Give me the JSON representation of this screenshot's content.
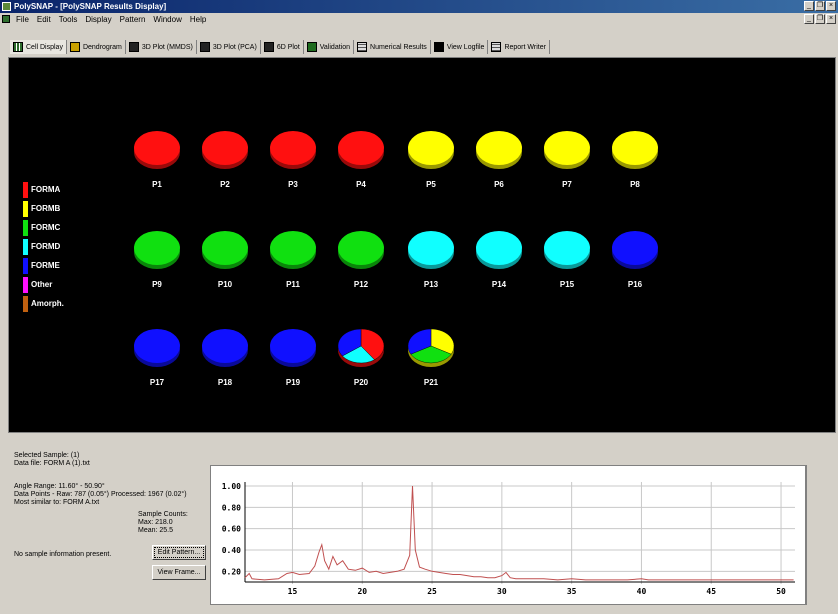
{
  "window": {
    "title": "PolySNAP - [PolySNAP Results Display]"
  },
  "menu": [
    "File",
    "Edit",
    "Tools",
    "Display",
    "Pattern",
    "Window",
    "Help"
  ],
  "tabs": [
    {
      "label": "Cell Display",
      "icon": "grid-icon"
    },
    {
      "label": "Dendrogram",
      "icon": "dendrogram-icon"
    },
    {
      "label": "3D Plot (MMDS)",
      "icon": "plot3d-icon"
    },
    {
      "label": "3D Plot (PCA)",
      "icon": "plot3d-icon"
    },
    {
      "label": "6D Plot",
      "icon": "plot6d-icon"
    },
    {
      "label": "Validation",
      "icon": "validation-icon"
    },
    {
      "label": "Numerical Results",
      "icon": "table-icon"
    },
    {
      "label": "View Logfile",
      "icon": "logfile-icon"
    },
    {
      "label": "Report Writer",
      "icon": "report-icon"
    }
  ],
  "legend": [
    {
      "label": "FORMA",
      "color": "#ff1010"
    },
    {
      "label": "FORMB",
      "color": "#ffff00"
    },
    {
      "label": "FORMC",
      "color": "#10e010"
    },
    {
      "label": "FORMD",
      "color": "#10ffff"
    },
    {
      "label": "FORME",
      "color": "#1010ff"
    },
    {
      "label": "Other",
      "color": "#ff10ff"
    },
    {
      "label": "Amorph.",
      "color": "#c06010"
    }
  ],
  "cells": [
    {
      "label": "P1",
      "color": "#ff1010"
    },
    {
      "label": "P2",
      "color": "#ff1010"
    },
    {
      "label": "P3",
      "color": "#ff1010"
    },
    {
      "label": "P4",
      "color": "#ff1010"
    },
    {
      "label": "P5",
      "color": "#ffff00"
    },
    {
      "label": "P6",
      "color": "#ffff00"
    },
    {
      "label": "P7",
      "color": "#ffff00"
    },
    {
      "label": "P8",
      "color": "#ffff00"
    },
    {
      "label": "P9",
      "color": "#10e010"
    },
    {
      "label": "P10",
      "color": "#10e010"
    },
    {
      "label": "P11",
      "color": "#10e010"
    },
    {
      "label": "P12",
      "color": "#10e010"
    },
    {
      "label": "P13",
      "color": "#10ffff"
    },
    {
      "label": "P14",
      "color": "#10ffff"
    },
    {
      "label": "P15",
      "color": "#10ffff"
    },
    {
      "label": "P16",
      "color": "#1010ff"
    },
    {
      "label": "P17",
      "color": "#1010ff"
    },
    {
      "label": "P18",
      "color": "#1010ff"
    },
    {
      "label": "P19",
      "color": "#1010ff"
    },
    {
      "label": "P20",
      "pie": [
        {
          "color": "#ff1010",
          "frac": 0.4
        },
        {
          "color": "#10ffff",
          "frac": 0.25
        },
        {
          "color": "#1010ff",
          "frac": 0.35
        }
      ]
    },
    {
      "label": "P21",
      "pie": [
        {
          "color": "#ffff00",
          "frac": 0.33
        },
        {
          "color": "#10e010",
          "frac": 0.34
        },
        {
          "color": "#1010ff",
          "frac": 0.33
        }
      ]
    }
  ],
  "info": {
    "selected": "Selected Sample: (1)",
    "datafile": "Data file: FORM A (1).txt",
    "angle_range": "Angle Range:          11.60° - 50.90°",
    "data_points": "Data Points - Raw: 787 (0.05°)   Processed: 1967 (0.02°)",
    "most_similar": "Most similar to: FORM A.txt",
    "sample_counts": "Sample Counts:",
    "max": "Max:   218.0",
    "mean": "Mean: 25.5",
    "no_info": "No sample information present.",
    "edit_btn": "Edit Pattern...",
    "view_btn": "View Frame..."
  },
  "chart_data": {
    "type": "line",
    "title": "",
    "xlabel": "",
    "ylabel": "",
    "xlim": [
      11.6,
      51
    ],
    "ylim": [
      0.1,
      1.0
    ],
    "xticks": [
      15,
      20,
      25,
      30,
      35,
      40,
      45,
      50
    ],
    "yticks": [
      0.2,
      0.4,
      0.6,
      0.8,
      1.0
    ],
    "ytick_labels": [
      "0.20",
      "0.40",
      "0.60",
      "0.80",
      "1.00"
    ],
    "series": [
      {
        "color": "#c05050",
        "points": [
          [
            11.6,
            0.14
          ],
          [
            11.9,
            0.18
          ],
          [
            12.1,
            0.13
          ],
          [
            13,
            0.12
          ],
          [
            14,
            0.13
          ],
          [
            14.6,
            0.18
          ],
          [
            15,
            0.19
          ],
          [
            15.5,
            0.17
          ],
          [
            16.2,
            0.18
          ],
          [
            16.6,
            0.25
          ],
          [
            16.9,
            0.38
          ],
          [
            17.1,
            0.45
          ],
          [
            17.3,
            0.3
          ],
          [
            17.6,
            0.22
          ],
          [
            17.9,
            0.34
          ],
          [
            18.2,
            0.26
          ],
          [
            18.6,
            0.3
          ],
          [
            19,
            0.22
          ],
          [
            19.5,
            0.21
          ],
          [
            20,
            0.23
          ],
          [
            20.5,
            0.19
          ],
          [
            21,
            0.2
          ],
          [
            21.5,
            0.18
          ],
          [
            22,
            0.19
          ],
          [
            22.5,
            0.2
          ],
          [
            23,
            0.22
          ],
          [
            23.4,
            0.35
          ],
          [
            23.6,
            1.0
          ],
          [
            23.8,
            0.4
          ],
          [
            24.1,
            0.24
          ],
          [
            24.5,
            0.22
          ],
          [
            25,
            0.2
          ],
          [
            25.5,
            0.19
          ],
          [
            26,
            0.18
          ],
          [
            26.5,
            0.17
          ],
          [
            27,
            0.17
          ],
          [
            27.5,
            0.16
          ],
          [
            28,
            0.15
          ],
          [
            28.5,
            0.15
          ],
          [
            29,
            0.14
          ],
          [
            29.5,
            0.14
          ],
          [
            30,
            0.16
          ],
          [
            30.3,
            0.19
          ],
          [
            30.6,
            0.14
          ],
          [
            31,
            0.13
          ],
          [
            32,
            0.13
          ],
          [
            33,
            0.13
          ],
          [
            34,
            0.12
          ],
          [
            35,
            0.13
          ],
          [
            36,
            0.12
          ],
          [
            37,
            0.12
          ],
          [
            38,
            0.12
          ],
          [
            39,
            0.12
          ],
          [
            40,
            0.13
          ],
          [
            40.5,
            0.12
          ],
          [
            41,
            0.12
          ],
          [
            42,
            0.12
          ],
          [
            43,
            0.12
          ],
          [
            44,
            0.12
          ],
          [
            45,
            0.12
          ],
          [
            46,
            0.12
          ],
          [
            47,
            0.12
          ],
          [
            48,
            0.12
          ],
          [
            49,
            0.12
          ],
          [
            50,
            0.12
          ],
          [
            50.9,
            0.12
          ]
        ]
      }
    ]
  }
}
